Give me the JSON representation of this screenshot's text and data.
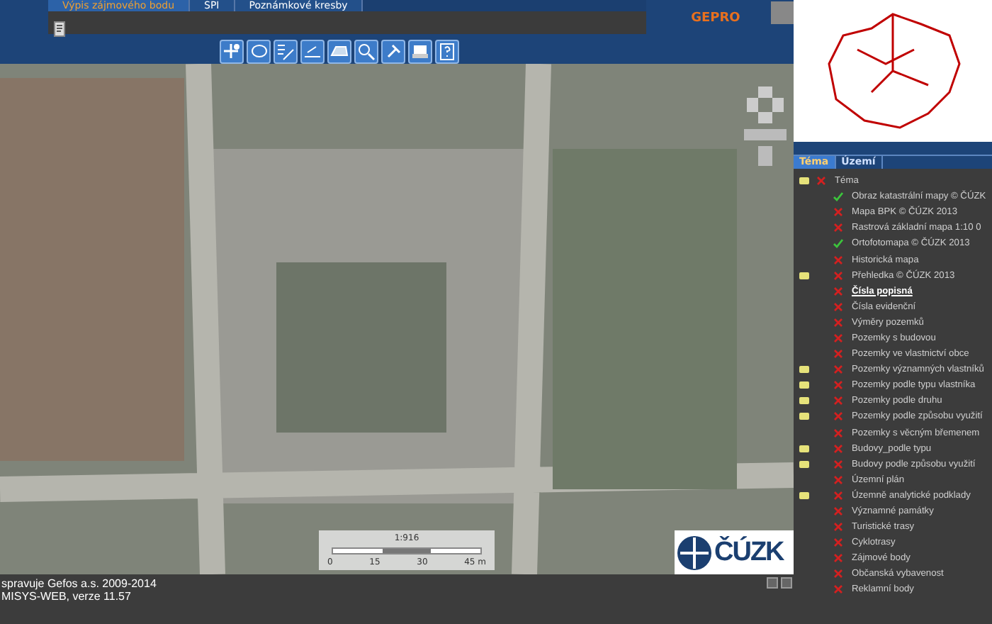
{
  "top_tabs": [
    {
      "label": "Výpis zájmového bodu",
      "selected": true
    },
    {
      "label": "SPI",
      "selected": false
    },
    {
      "label": "Poznámkové kresby",
      "selected": false
    }
  ],
  "logo": "GEPRO",
  "scale": {
    "ratio": "1:916",
    "ticks": [
      "0",
      "15",
      "30",
      "45 m"
    ]
  },
  "map_logo": "ČÚZK",
  "status_lines": [
    "spravuje Gefos a.s. 2009-2014",
    "MISYS-WEB, verze 11.57"
  ],
  "panel_tabs": [
    {
      "label": "Téma",
      "selected": true
    },
    {
      "label": "Území",
      "selected": false
    }
  ],
  "layers": [
    {
      "label": "Téma",
      "folder": true,
      "visible": false,
      "selected": false,
      "children": [
        {
          "label": "Obraz katastrální mapy © ČÚZK",
          "folder": false,
          "visible": true,
          "selected": false
        },
        {
          "label": "Mapa BPK © ČÚZK 2013",
          "folder": false,
          "visible": false,
          "selected": false
        },
        {
          "label": "Rastrová základní mapa 1:10 0",
          "folder": false,
          "visible": false,
          "selected": false
        },
        {
          "label": "Ortofotomapa © ČÚZK 2013",
          "folder": false,
          "visible": true,
          "selected": false
        },
        {
          "label": "Historická mapa",
          "folder": false,
          "visible": false,
          "selected": false
        },
        {
          "label": "Přehledka © ČÚZK 2013",
          "folder": true,
          "visible": false,
          "selected": false
        },
        {
          "label": "Čísla popisná",
          "folder": false,
          "visible": false,
          "selected": true
        },
        {
          "label": "Čísla evidenční",
          "folder": false,
          "visible": false,
          "selected": false
        },
        {
          "label": "Výměry pozemků",
          "folder": false,
          "visible": false,
          "selected": false
        },
        {
          "label": "Pozemky s budovou",
          "folder": false,
          "visible": false,
          "selected": false
        },
        {
          "label": "Pozemky ve vlastnictví obce",
          "folder": false,
          "visible": false,
          "selected": false
        },
        {
          "label": "Pozemky významných vlastníků",
          "folder": true,
          "visible": false,
          "selected": false
        },
        {
          "label": "Pozemky podle typu vlastníka",
          "folder": true,
          "visible": false,
          "selected": false
        },
        {
          "label": "Pozemky podle druhu",
          "folder": true,
          "visible": false,
          "selected": false
        },
        {
          "label": "Pozemky podle způsobu využití",
          "folder": true,
          "visible": false,
          "selected": false
        },
        {
          "label": "Pozemky s věcným břemenem",
          "folder": false,
          "visible": false,
          "selected": false
        },
        {
          "label": "Budovy_podle typu",
          "folder": true,
          "visible": false,
          "selected": false
        },
        {
          "label": "Budovy podle způsobu využití",
          "folder": true,
          "visible": false,
          "selected": false
        },
        {
          "label": "Územní plán",
          "folder": false,
          "visible": false,
          "selected": false
        },
        {
          "label": "Územně analytické podklady",
          "folder": true,
          "visible": false,
          "selected": false
        },
        {
          "label": "Významné památky",
          "folder": false,
          "visible": false,
          "selected": false
        },
        {
          "label": "Turistické trasy",
          "folder": false,
          "visible": false,
          "selected": false
        },
        {
          "label": "Cyklotrasy",
          "folder": false,
          "visible": false,
          "selected": false
        },
        {
          "label": "Zájmové body",
          "folder": false,
          "visible": false,
          "selected": false
        },
        {
          "label": "Občanská vybavenost",
          "folder": false,
          "visible": false,
          "selected": false
        },
        {
          "label": "Reklamní body",
          "folder": false,
          "visible": false,
          "selected": false
        }
      ]
    }
  ]
}
